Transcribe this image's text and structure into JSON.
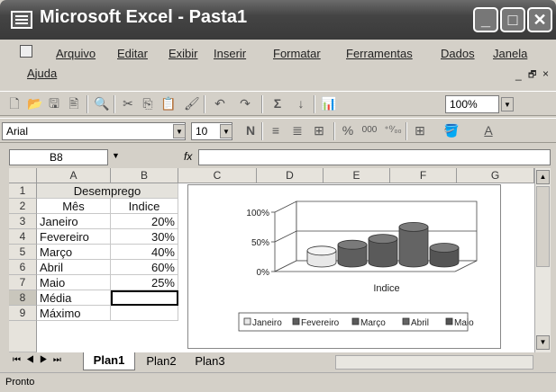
{
  "window": {
    "title": "Microsoft Excel - Pasta1"
  },
  "menu": {
    "items": [
      "Arquivo",
      "Editar",
      "Exibir",
      "Inserir",
      "Formatar",
      "Ferramentas",
      "Dados",
      "Janela",
      "Ajuda"
    ]
  },
  "toolbar": {
    "zoom": "100%"
  },
  "format_toolbar": {
    "font": "Arial",
    "size": "10",
    "bold": "N",
    "percent": "%",
    "thousands": "000",
    "decimals": "⁺⁰⁄₀₀"
  },
  "formula_bar": {
    "name_box": "B8",
    "fx": "fx",
    "formula": ""
  },
  "grid": {
    "columns": [
      "A",
      "B",
      "C",
      "D",
      "E",
      "F",
      "G"
    ],
    "rows": [
      "1",
      "2",
      "3",
      "4",
      "5",
      "6",
      "7",
      "8",
      "9"
    ],
    "merged_title": "Desemprego",
    "header": {
      "a": "Mês",
      "b": "Indice"
    },
    "data": [
      {
        "a": "Janeiro",
        "b": "20%"
      },
      {
        "a": "Fevereiro",
        "b": "30%"
      },
      {
        "a": "Março",
        "b": "40%"
      },
      {
        "a": "Abril",
        "b": "60%"
      },
      {
        "a": "Maio",
        "b": "25%"
      }
    ],
    "r8": "Média",
    "r9": "Máximo"
  },
  "chart_data": {
    "type": "bar",
    "categories": [
      "Indice"
    ],
    "series": [
      {
        "name": "Janeiro",
        "values": [
          0.2
        ]
      },
      {
        "name": "Fevereiro",
        "values": [
          0.3
        ]
      },
      {
        "name": "Março",
        "values": [
          0.4
        ]
      },
      {
        "name": "Abril",
        "values": [
          0.6
        ]
      },
      {
        "name": "Maio",
        "values": [
          0.25
        ]
      }
    ],
    "yticks": [
      "100%",
      "50%",
      "0%"
    ],
    "ylim": [
      0,
      1
    ],
    "xlabel": "Indice",
    "legend": "bottom"
  },
  "sheets": {
    "tabs": [
      "Plan1",
      "Plan2",
      "Plan3"
    ],
    "active": "Plan1"
  },
  "status": {
    "text": "Pronto"
  }
}
